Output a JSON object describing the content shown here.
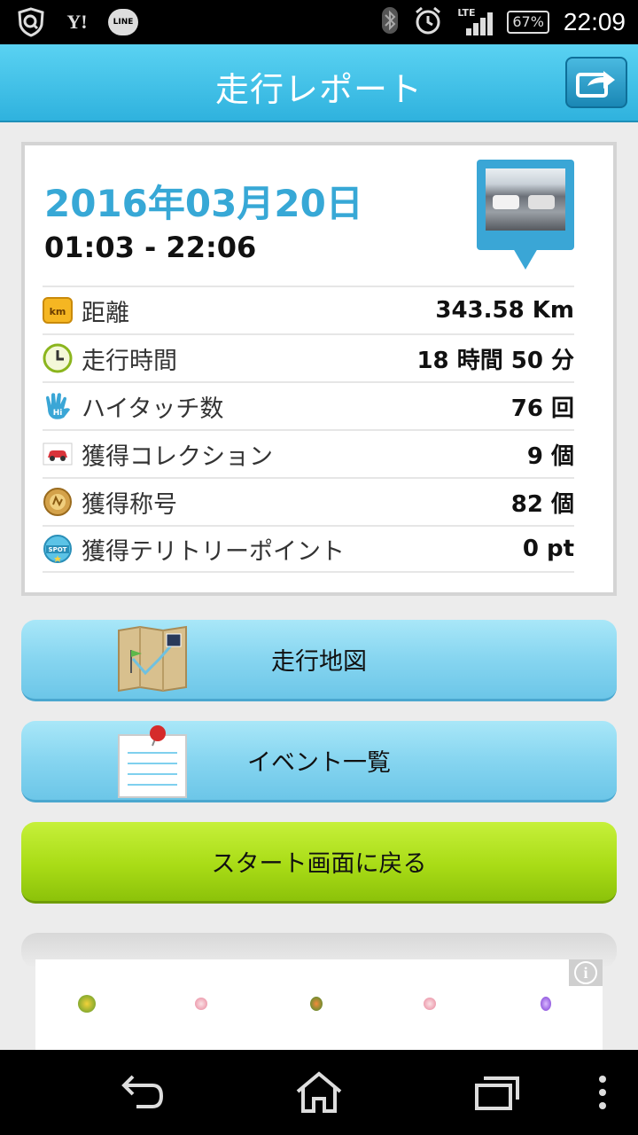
{
  "status_bar": {
    "time": "22:09",
    "battery": "67%",
    "network": "LTE",
    "left_icons": [
      "shield-search-icon",
      "yahoo-icon",
      "line-icon"
    ],
    "yahoo_text": "Y!",
    "line_text": "LINE"
  },
  "header": {
    "title": "走行レポート",
    "share_icon": "share-icon"
  },
  "report": {
    "date": "2016年03月20日",
    "time_range": "01:03 - 22:06",
    "rows": [
      {
        "icon": "km-icon",
        "icon_text": "km",
        "label": "距離",
        "value": "343.58 Km"
      },
      {
        "icon": "clock-icon",
        "label": "走行時間",
        "value": "18 時間 50 分"
      },
      {
        "icon": "hi-five-icon",
        "icon_text": "Hi",
        "label": "ハイタッチ数",
        "value": "76 回"
      },
      {
        "icon": "car-icon",
        "label": "獲得コレクション",
        "value": "9 個"
      },
      {
        "icon": "medal-icon",
        "label": "獲得称号",
        "value": "82 個"
      },
      {
        "icon": "spot-icon",
        "icon_text": "SPOT",
        "label": "獲得テリトリーポイント",
        "value": "0 pt"
      }
    ]
  },
  "buttons": {
    "map": "走行地図",
    "events": "イベント一覧",
    "back_to_start": "スタート画面に戻る"
  },
  "ad": {
    "info_glyph": "i"
  },
  "colors": {
    "header_blue": "#2fb2de",
    "date_blue": "#37a8d6",
    "button_blue": "#86d5f0",
    "button_green": "#a9dc16"
  }
}
